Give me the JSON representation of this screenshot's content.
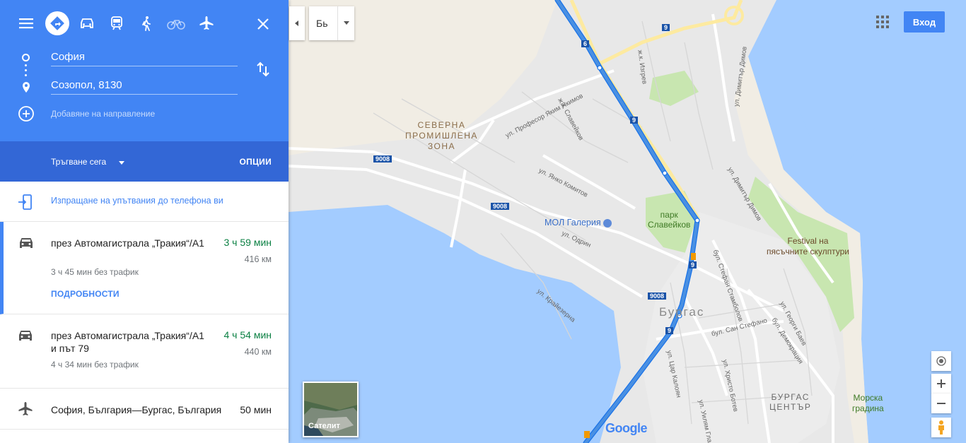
{
  "header": {
    "modes": [
      {
        "name": "best-route",
        "icon": "directions-icon"
      },
      {
        "name": "driving",
        "icon": "car-icon"
      },
      {
        "name": "transit",
        "icon": "train-icon"
      },
      {
        "name": "walking",
        "icon": "walk-icon"
      },
      {
        "name": "cycling",
        "icon": "bike-icon"
      },
      {
        "name": "flight",
        "icon": "plane-icon"
      }
    ],
    "origin": "София",
    "destination": "Созопол, 8130",
    "add_destination": "Добавяне на направление",
    "depart_label": "Тръгване сега",
    "options_label": "ОПЦИИ"
  },
  "send_to_phone": "Изпращане на упътвания до телефона ви",
  "routes": [
    {
      "name": "през Автомагистрала „Тракия“/A1",
      "time": "3 ч 59 мин",
      "distance": "416 км",
      "note": "3 ч 45 мин без трафик",
      "details": "ПОДРОБНОСТИ"
    },
    {
      "name": "през Автомагистрала „Тракия“/A1 и път 79",
      "time": "4 ч 54 мин",
      "distance": "440 км",
      "note": "4 ч 34 мин без трафик"
    }
  ],
  "flight": {
    "name": "София, България—Бургас, България",
    "time": "50 мин"
  },
  "map": {
    "lang": "Бь",
    "login": "Вход",
    "satellite": "Сателит",
    "logo": "Google",
    "labels": {
      "north_zone": [
        "СЕВЕРНА",
        "ПРОМИШЛЕНА",
        "ЗОНА"
      ],
      "mall": "МОЛ Галерия",
      "park": [
        "парк",
        "Славейков"
      ],
      "festival": [
        "Festival на",
        "пясъчните скулптури"
      ],
      "burgas": "Бургас",
      "center": [
        "БУРГАС",
        "ЦЕНТЪР"
      ],
      "sea_garden": [
        "Морска",
        "градина"
      ]
    },
    "streets": [
      "ул. Професор Яким Якимов",
      "ж.к. Славейков",
      "ж.к. Изгрев",
      "ул. Димитър Димов",
      "ул. Янко Комитов",
      "ул. Одрин",
      "ул. Крайезерна",
      "бул. Стефан Стамболов",
      "бул. Сан Стефано",
      "ул. Христо Ботев",
      "ул. Цар Калоян",
      "ул. Уилям Гладстон",
      "ул. Георги Баев",
      "бул. Демокрация"
    ],
    "road_shields": [
      "9008",
      "9008",
      "9008",
      "9",
      "9",
      "9",
      "9",
      "6"
    ],
    "colors": {
      "route": "#4a90e2",
      "water": "#a3ccff",
      "land": "#e8e8e8",
      "park": "#c8e6b0",
      "primary_road": "#fdeaa0"
    }
  }
}
